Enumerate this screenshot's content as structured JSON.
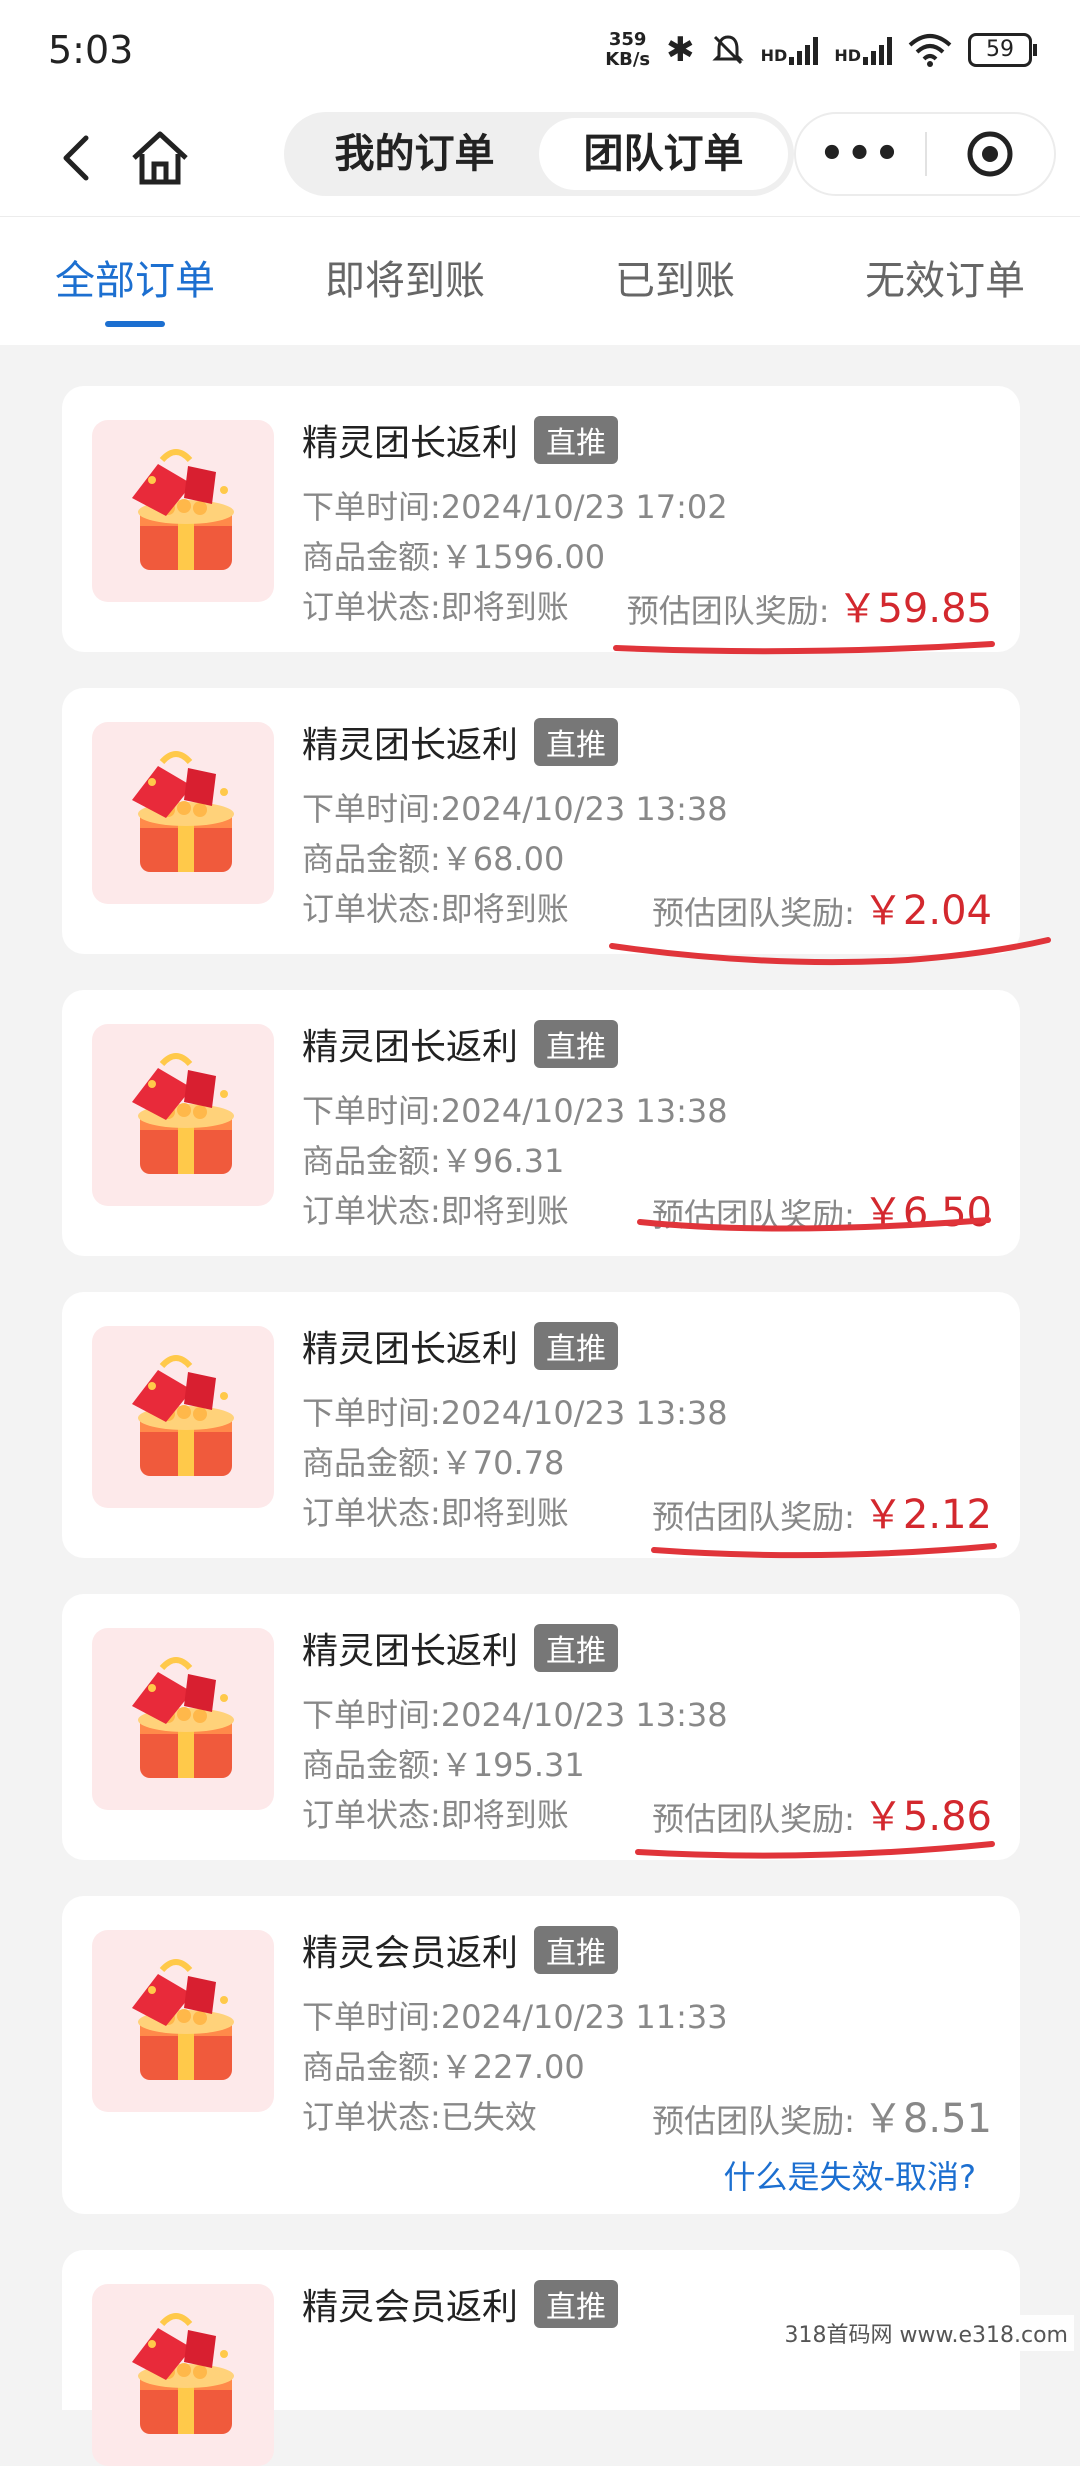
{
  "status": {
    "time": "5:03",
    "speed_top": "359",
    "speed_bottom": "KB/s",
    "hd1": "HD",
    "hd2": "HD",
    "battery": "59"
  },
  "nav": {
    "segments": [
      "我的订单",
      "团队订单"
    ],
    "more": "•••"
  },
  "tabs": [
    "全部订单",
    "即将到账",
    "已到账",
    "无效订单"
  ],
  "orders": [
    {
      "title": "精灵团长返利",
      "tag": "直推",
      "time": "下单时间:2024/10/23 17:02",
      "amount": "商品金额:￥1596.00",
      "status": "订单状态:即将到账",
      "reward_label": "预估团队奖励:",
      "reward": "￥59.85"
    },
    {
      "title": "精灵团长返利",
      "tag": "直推",
      "time": "下单时间:2024/10/23 13:38",
      "amount": "商品金额:￥68.00",
      "status": "订单状态:即将到账",
      "reward_label": "预估团队奖励:",
      "reward": "￥2.04"
    },
    {
      "title": "精灵团长返利",
      "tag": "直推",
      "time": "下单时间:2024/10/23 13:38",
      "amount": "商品金额:￥96.31",
      "status": "订单状态:即将到账",
      "reward_label": "预估团队奖励:",
      "reward": "￥6.50"
    },
    {
      "title": "精灵团长返利",
      "tag": "直推",
      "time": "下单时间:2024/10/23 13:38",
      "amount": "商品金额:￥70.78",
      "status": "订单状态:即将到账",
      "reward_label": "预估团队奖励:",
      "reward": "￥2.12"
    },
    {
      "title": "精灵团长返利",
      "tag": "直推",
      "time": "下单时间:2024/10/23 13:38",
      "amount": "商品金额:￥195.31",
      "status": "订单状态:即将到账",
      "reward_label": "预估团队奖励:",
      "reward": "￥5.86"
    },
    {
      "title": "精灵会员返利",
      "tag": "直推",
      "time": "下单时间:2024/10/23 11:33",
      "amount": "商品金额:￥227.00",
      "status": "订单状态:已失效",
      "reward_label": "预估团队奖励:",
      "reward": "￥8.51",
      "link": "什么是失效-取消?"
    },
    {
      "title": "精灵会员返利",
      "tag": "直推"
    }
  ],
  "watermark": "318首码网 www.e318.com",
  "colors": {
    "accent": "#1c6fd0",
    "reward": "#d3282e",
    "annotation": "#e0343a"
  }
}
